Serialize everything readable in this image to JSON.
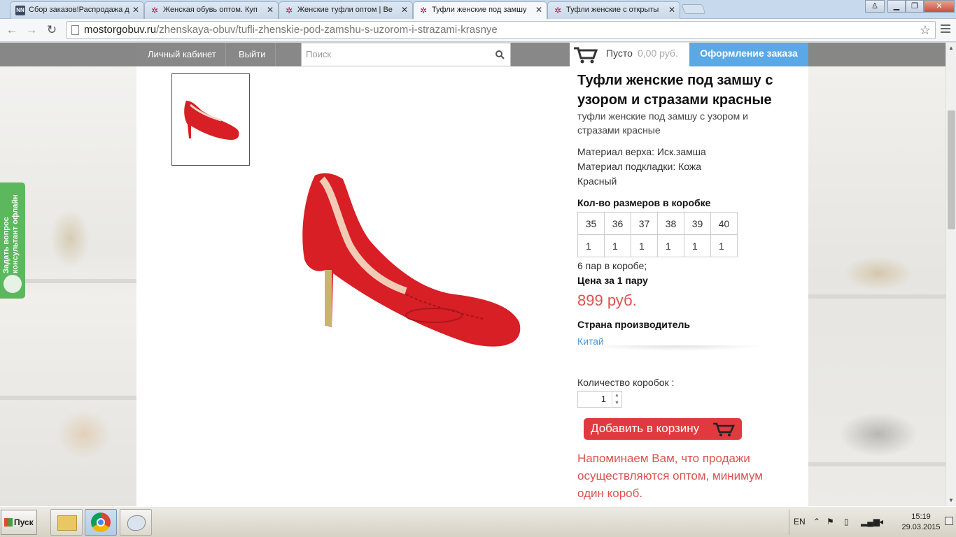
{
  "tabs": [
    {
      "title": "Сбор заказов!Распродажа д",
      "favicon": "nn-icon"
    },
    {
      "title": "Женская обувь оптом. Куп",
      "favicon": "flower-icon"
    },
    {
      "title": "Женские туфли оптом | Ве",
      "favicon": "flower-icon"
    },
    {
      "title": "Туфли женские под замшу",
      "favicon": "flower-icon",
      "active": true
    },
    {
      "title": "Туфли женские с открыты",
      "favicon": "flower-icon"
    }
  ],
  "address": {
    "host": "mostorgobuv.ru",
    "path": "/zhenskaya-obuv/tufli-zhenskie-pod-zamshu-s-uzorom-i-strazami-krasnye"
  },
  "topnav": {
    "account": "Личный кабинет",
    "logout": "Выйти",
    "search_placeholder": "Поиск",
    "cart_status": "Пусто",
    "cart_sum": "0,00 руб.",
    "checkout": "Оформление заказа"
  },
  "consultant": {
    "line1": "Задать вопрос",
    "line2": "консультант офлайн"
  },
  "product": {
    "title": "Туфли женские под замшу с узором и стразами красные",
    "subtitle": "туфли женские под замшу с узором и стразами красные",
    "material_top": "Материал верха: Иск.замша",
    "material_lining": "Материал подкладки: Кожа",
    "color": "Красный",
    "sizes_label": "Кол-во размеров в коробке",
    "sizes": [
      "35",
      "36",
      "37",
      "38",
      "39",
      "40"
    ],
    "counts": [
      "1",
      "1",
      "1",
      "1",
      "1",
      "1"
    ],
    "pairs_in_box": "6 пар в коробе;",
    "price_label": "Цена за 1 пару",
    "price": "899 руб.",
    "country_label": "Страна производитель",
    "country": "Китай",
    "qty_label": "Количество коробок :",
    "qty_value": "1",
    "add_to_cart": "Добавить в корзину",
    "notice": "Напоминаем Вам, что продажи осуществляются оптом, минимум один короб."
  },
  "taskbar": {
    "start": "Пуск",
    "lang": "EN",
    "time": "15:19",
    "date": "29.03.2015"
  },
  "colors": {
    "price": "#d9534f",
    "checkout": "#5aa9e6",
    "add_button": "#e03a3e",
    "consultant": "#5cb85c",
    "shoe": "#d81f26"
  }
}
